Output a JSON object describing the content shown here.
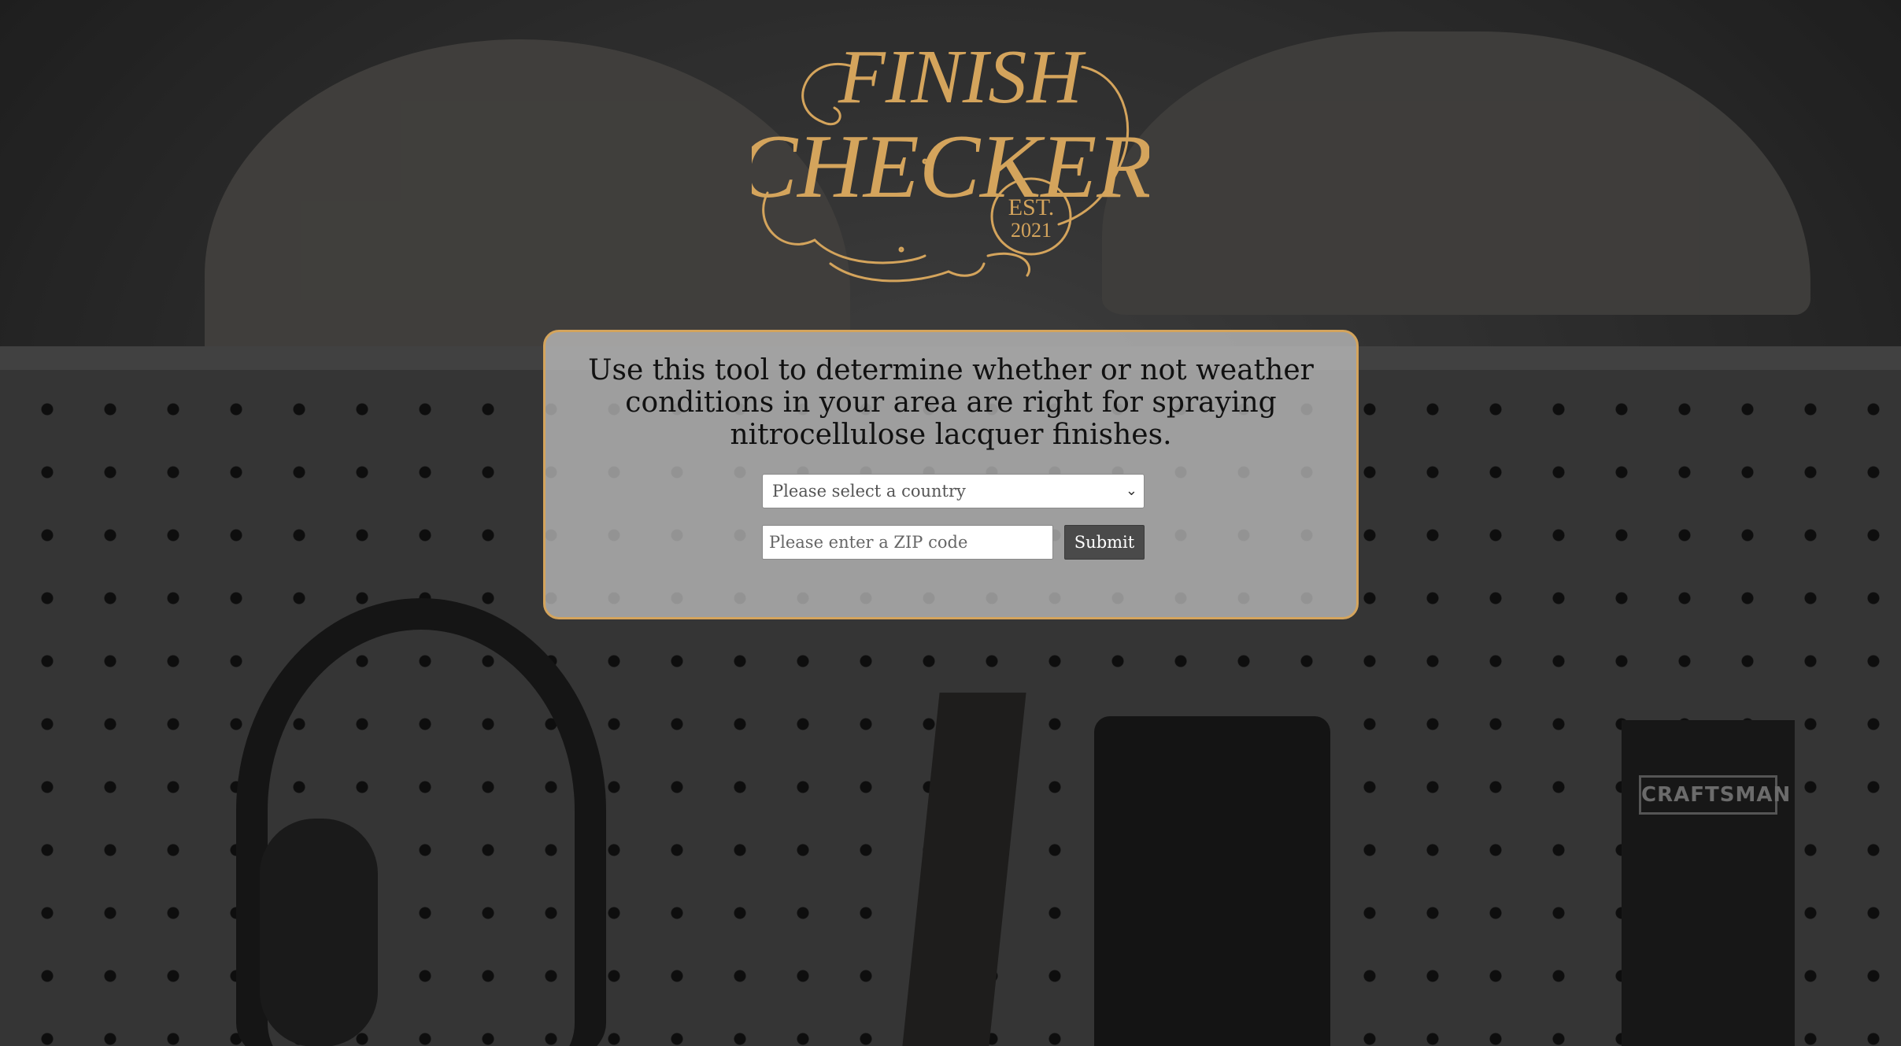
{
  "logo": {
    "line1": "FINISH",
    "line2": "CHECKER",
    "est_line1": "EST.",
    "est_line2": "2021",
    "color": "#d4a45c"
  },
  "background": {
    "brand_label": "CRAFTSMAN"
  },
  "card": {
    "intro_text": "Use this tool to determine whether or not weather conditions in your area are right for spraying nitrocellulose lacquer finishes.",
    "country_select": {
      "selected_label": "Please select a country"
    },
    "zip_input": {
      "placeholder": "Please enter a ZIP code",
      "value": ""
    },
    "submit_label": "Submit",
    "border_color": "#d4a45c"
  }
}
